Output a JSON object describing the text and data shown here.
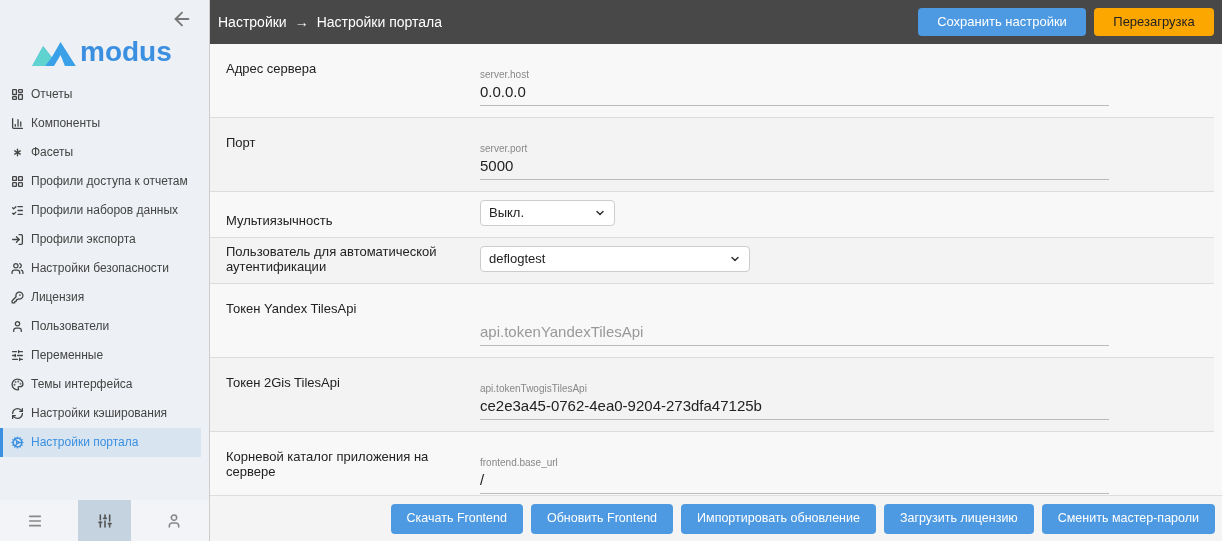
{
  "sidebar": {
    "logo": "modus",
    "items": [
      {
        "label": "Отчеты",
        "selected": false
      },
      {
        "label": "Компоненты",
        "selected": false
      },
      {
        "label": "Фасеты",
        "selected": false
      },
      {
        "label": "Профили доступа к отчетам",
        "selected": false
      },
      {
        "label": "Профили наборов данных",
        "selected": false
      },
      {
        "label": "Профили экспорта",
        "selected": false
      },
      {
        "label": "Настройки безопасности",
        "selected": false
      },
      {
        "label": "Лицензия",
        "selected": false
      },
      {
        "label": "Пользователи",
        "selected": false
      },
      {
        "label": "Переменные",
        "selected": false
      },
      {
        "label": "Темы интерфейса",
        "selected": false
      },
      {
        "label": "Настройки кэширования",
        "selected": false
      },
      {
        "label": "Настройки портала",
        "selected": true
      }
    ],
    "bottom_tabs": [
      {
        "selected": false
      },
      {
        "selected": true
      },
      {
        "selected": false
      }
    ]
  },
  "header": {
    "breadcrumb": [
      "Настройки",
      "→",
      "Настройки портала"
    ],
    "buttons": [
      {
        "label": "Сохранить настройки",
        "kind": "primary"
      },
      {
        "label": "Перезагрузка",
        "kind": "warning"
      }
    ]
  },
  "settings": [
    {
      "label": "Адрес сервера",
      "kind": "text",
      "field_label": "server.host",
      "value": "0.0.0.0"
    },
    {
      "label": "Порт",
      "kind": "text",
      "field_label": "server.port",
      "value": "5000"
    },
    {
      "label": "Мультиязычность",
      "kind": "select",
      "value": "Выкл."
    },
    {
      "label": "Пользователь для автоматической аутентификации",
      "kind": "select",
      "value": "deflogtest"
    },
    {
      "label": "Токен Yandex TilesApi",
      "kind": "text",
      "placeholder": "api.tokenYandexTilesApi"
    },
    {
      "label": "Токен 2Gis TilesApi",
      "kind": "text",
      "field_label": "api.tokenTwogisTilesApi",
      "value": "ce2e3a45-0762-4ea0-9204-273dfa47125b"
    },
    {
      "label": "Корневой каталог приложения на сервере",
      "kind": "text",
      "field_label": "frontend.base_url",
      "value": "/"
    }
  ],
  "footer_buttons": [
    "Скачать Frontend",
    "Обновить Frontend",
    "Импортировать обновление",
    "Загрузить лицензию",
    "Сменить мастер-пароли"
  ]
}
